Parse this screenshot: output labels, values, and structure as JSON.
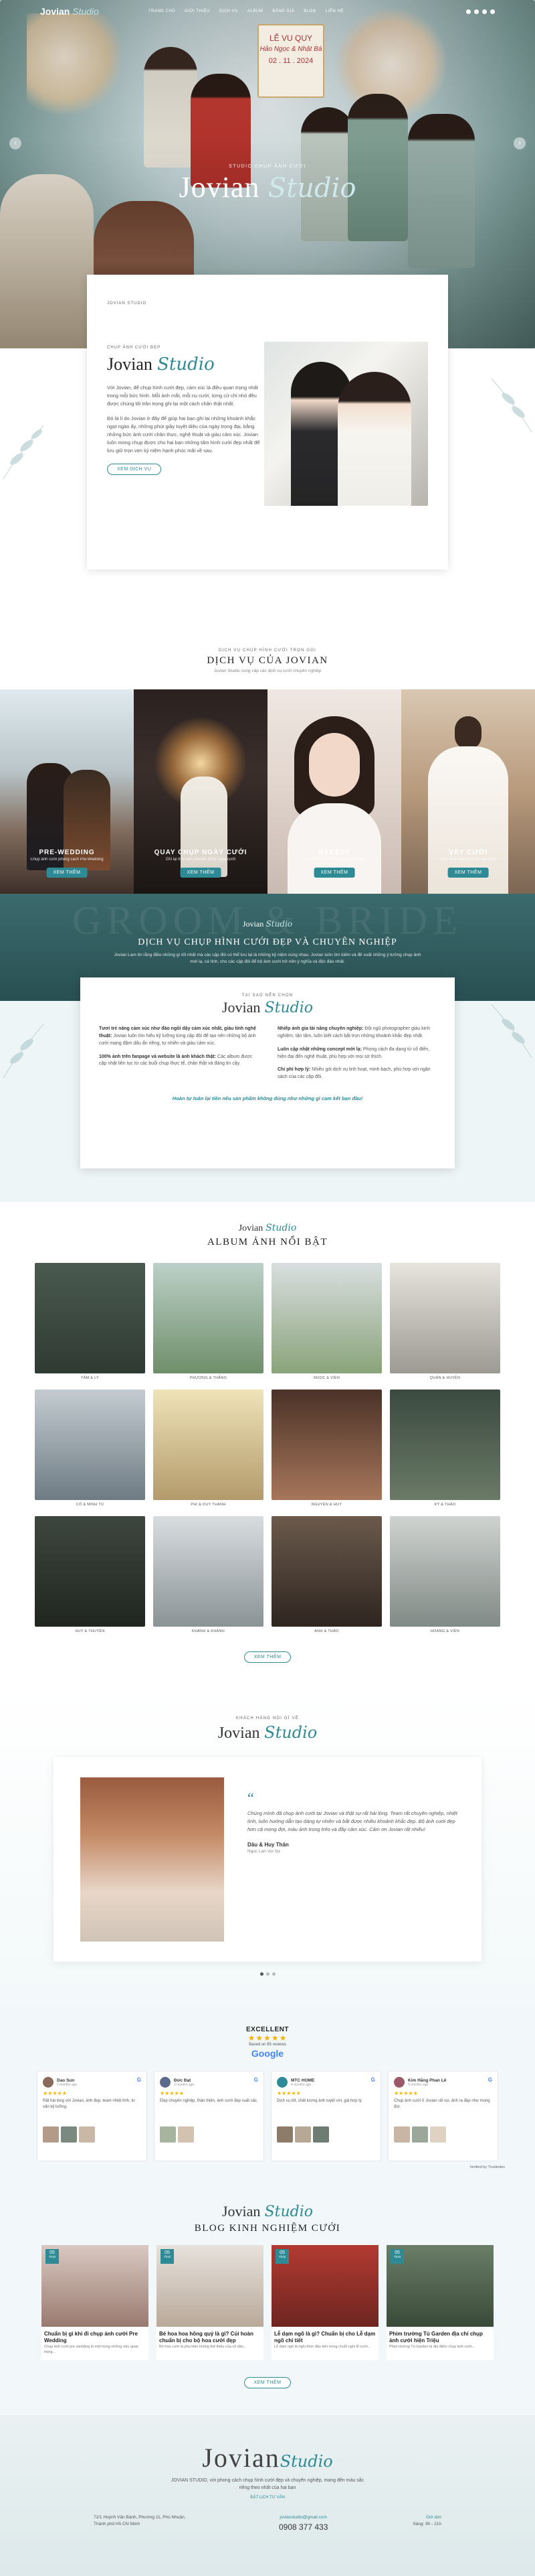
{
  "nav": {
    "logo_main": "Jovian",
    "logo_script": "Studio",
    "items": [
      "Trang chủ",
      "Giới thiệu",
      "Dịch vụ",
      "Album",
      "Bảng giá",
      "Blog",
      "Liên hệ"
    ]
  },
  "hero": {
    "sign_line1": "LỄ VU QUY",
    "sign_names": "Hảo Ngọc & Nhật Bá",
    "sign_date": "02 . 11 . 2024",
    "kicker": "Studio chụp ảnh cưới",
    "brand_main": "Jovian",
    "brand_script": "Studio",
    "prev": "‹",
    "next": "›"
  },
  "about": {
    "kicker_top": "Jovian Studio",
    "kicker": "Chụp ảnh cưới đẹp",
    "title_main": "Jovian",
    "title_script": "Studio",
    "p1": "Với Jovian, để chụp hình cưới đẹp, cảm xúc là điều quan trọng nhất trong mỗi bức hình. Mỗi ảnh mắt, mỗi nụ cười, từng cử chỉ nhỏ đều được chúng tôi trân trọng ghi lại một cách chân thật nhất.",
    "p2": "Đó là lí do Jovian ở đây để giúp hai bạn ghi lại những khoảnh khắc ngọt ngào ấy, những phút giây tuyệt diệu của ngày trọng đại, bằng những bức ảnh cưới chân thực, nghệ thuật và giàu cảm xúc. Jovian luôn mong chụp được cho hai bạn những tấm hình cưới đẹp nhất để lưu giữ trọn vẹn kỷ niệm hạnh phúc mãi về sau.",
    "button": "Xem dịch vụ"
  },
  "services": {
    "kicker": "Dịch vụ chụp hình cưới trọn gói",
    "title": "Dịch vụ của Jovian",
    "sub": "Jovian Studio cung cấp các dịch vụ cưới chuyên nghiệp",
    "items": [
      {
        "title": "Pre-Wedding",
        "desc": "Chụp ảnh cưới phong cách Pre-Wedding",
        "button": "Xem thêm"
      },
      {
        "title": "Quay chụp ngày cưới",
        "desc": "Ghi lại trọn vẹn khoảnh khắc ngày cưới",
        "button": "Xem thêm"
      },
      {
        "title": "Makeup",
        "desc": "Trang điểm cô dâu chuyên nghiệp",
        "button": "Xem thêm"
      },
      {
        "title": "Váy cưới",
        "desc": "Cho thuê váy cưới, áo dài cưới",
        "button": "Xem thêm"
      }
    ]
  },
  "banner": {
    "bg_text": "GROOM & BRIDE",
    "brand_main": "Jovian",
    "brand_script": "Studio",
    "title": "Dịch vụ chụp hình cưới đẹp và chuyên nghiệp",
    "desc": "Jovian Lam tin rằng điều những gì tốt nhất mà các cặp đôi có thể lưu lại là những kỷ niệm cùng nhau. Jovian luôn tìm kiếm và đề xuất những ý tưởng chụp ảnh mới lạ, cá tính, cho các cặp đôi để bộ ảnh cưới trở nên ý nghĩa và độc đáo nhất."
  },
  "feature": {
    "kicker": "Tại sao nên chọn",
    "brand_main": "Jovian",
    "brand_script": "Studio",
    "col1": [
      {
        "bold": "Tươi trẻ năng cảm xúc như đào ngồi dậy cảm xúc nhất, giàu tính nghệ thuật:",
        "text": " Jovian luôn tìm hiểu kỹ lưỡng từng cặp đôi để tạo nên những bộ ảnh cưới mang đậm dấu ấn riêng, tự nhiên và giàu cảm xúc."
      },
      {
        "bold": "100% ảnh trên fanpage và website là ảnh khách thật:",
        "text": " Các album được cập nhật liên tục từ các buổi chụp thực tế, chân thật và đáng tin cậy."
      }
    ],
    "col2": [
      {
        "bold": "Nhiếp ảnh gia tài năng chuyên nghiệp:",
        "text": " Đội ngũ photographer giàu kinh nghiệm, tận tâm, luôn biết cách bắt trọn những khoảnh khắc đẹp nhất."
      },
      {
        "bold": "Luôn cập nhật những concept mới lạ:",
        "text": " Phong cách đa dạng từ cổ điển, hiện đại đến nghệ thuật, phù hợp với mọi sở thích."
      },
      {
        "bold": "Chi phí hợp lý:",
        "text": " Nhiều gói dịch vụ linh hoạt, minh bạch, phù hợp với ngân sách của các cặp đôi."
      }
    ],
    "cta": "Hoàn tự tuân lại tiền nếu sản phẩm không đúng như những gì cam kết ban đầu!"
  },
  "album": {
    "brand_main": "Jovian",
    "brand_script": "Studio",
    "title": "Album ảnh nổi bật",
    "items": [
      "Tâm & Ly",
      "Phương & Thắng",
      "Ngọc & Viên",
      "Quân & Huyền",
      "Cô & Minh Tú",
      "Phi & Duy Thanh",
      "Nguyên & Huy",
      "Kỷ & Thảo",
      "Huy & Thuyên",
      "Khánh & Khánh",
      "Anh & Thảo",
      "Hoàng & Viên"
    ],
    "button": "Xem thêm"
  },
  "testimonial": {
    "kicker": "Khách hàng nói gì về",
    "brand_main": "Jovian",
    "brand_script": "Studio",
    "quote_mark": "“",
    "text": "Chúng mình đã chụp ảnh cưới tại Jovian và thật sự rất hài lòng. Team rất chuyên nghiệp, nhiệt tình, luôn hướng dẫn tạo dáng tự nhiên và bắt được nhiều khoảnh khắc đẹp. Bộ ảnh cưới đẹp hơn cả mong đợi, màu ảnh trong trẻo và đầy cảm xúc. Cảm ơn Jovian rất nhiều!",
    "name": "Dâu & Huy Thân",
    "role": "Ngọc Lan Vui Sự"
  },
  "reviews": {
    "excellent": "EXCELLENT",
    "stars": "★★★★★",
    "based": "Based on 85 reviews",
    "google": "Google",
    "items": [
      {
        "name": "Dao Sun",
        "time": "2 months ago",
        "text": "Rất hài lòng với Jovian, ảnh đẹp, team nhiệt tình, tư vấn kỹ lưỡng."
      },
      {
        "name": "Đức Đạt",
        "time": "3 months ago",
        "text": "Ekip chuyên nghiệp, thân thiện, ảnh cưới đẹp xuất sắc."
      },
      {
        "name": "MTC HOME",
        "time": "4 months ago",
        "text": "Dịch vụ tốt, chất lượng ảnh tuyệt vời, giá hợp lý."
      },
      {
        "name": "Kim Hằng Phan Lê",
        "time": "5 months ago",
        "text": "Chụp ảnh cưới ở Jovian rất vui, ảnh ra đẹp như mong đợi."
      }
    ],
    "verified": "Verified by Trustindex"
  },
  "blog": {
    "brand_main": "Jovian",
    "brand_script": "Studio",
    "title": "Blog kinh nghiệm cưới",
    "items": [
      {
        "day": "05",
        "month": "Th10",
        "title": "Chuẩn bị gì khi đi chụp ảnh cưới Pre Wedding",
        "excerpt": "Chụp ảnh cưới pre wedding là một trong những việc quan trọng..."
      },
      {
        "day": "05",
        "month": "Th10",
        "title": "Bé hoa hoa hồng quý là gì? Cúi hoàn chuẩn bị cho bộ hoa cưới đẹp",
        "excerpt": "Bó hoa cưới là phụ kiện không thể thiếu của cô dâu..."
      },
      {
        "day": "05",
        "month": "Th10",
        "title": "Lễ dạm ngõ là gì? Chuẩn bị cho Lễ dạm ngõ chi tiết",
        "excerpt": "Lễ dạm ngõ là nghi thức đầu tiên trong chuỗi nghi lễ cưới..."
      },
      {
        "day": "05",
        "month": "Th10",
        "title": "Phim trường Tú Garden địa chỉ chụp ảnh cưới hiện Triệu",
        "excerpt": "Phim trường Tú Garden là địa điểm chụp ảnh cưới..."
      }
    ],
    "button": "Xem thêm"
  },
  "footer": {
    "logo_main": "Jovian",
    "logo_script": "Studio",
    "desc": "JOVIAN STUDIO, với phong cách chụp hình cưới đẹp và chuyên nghiệp, mang đến màu sắc riêng theo nhất của hai bạn",
    "link": "Đặt lịch tư vấn",
    "address": "72/1 Huỳnh Văn Bánh, Phường 11, Phú Nhuận, Thành phố Hồ Chí Minh",
    "email": "jovianstudio@gmail.com",
    "phone": "0908 377 433",
    "hours_label": "Giờ làm",
    "hours": "Sáng: 9h - 21h"
  }
}
